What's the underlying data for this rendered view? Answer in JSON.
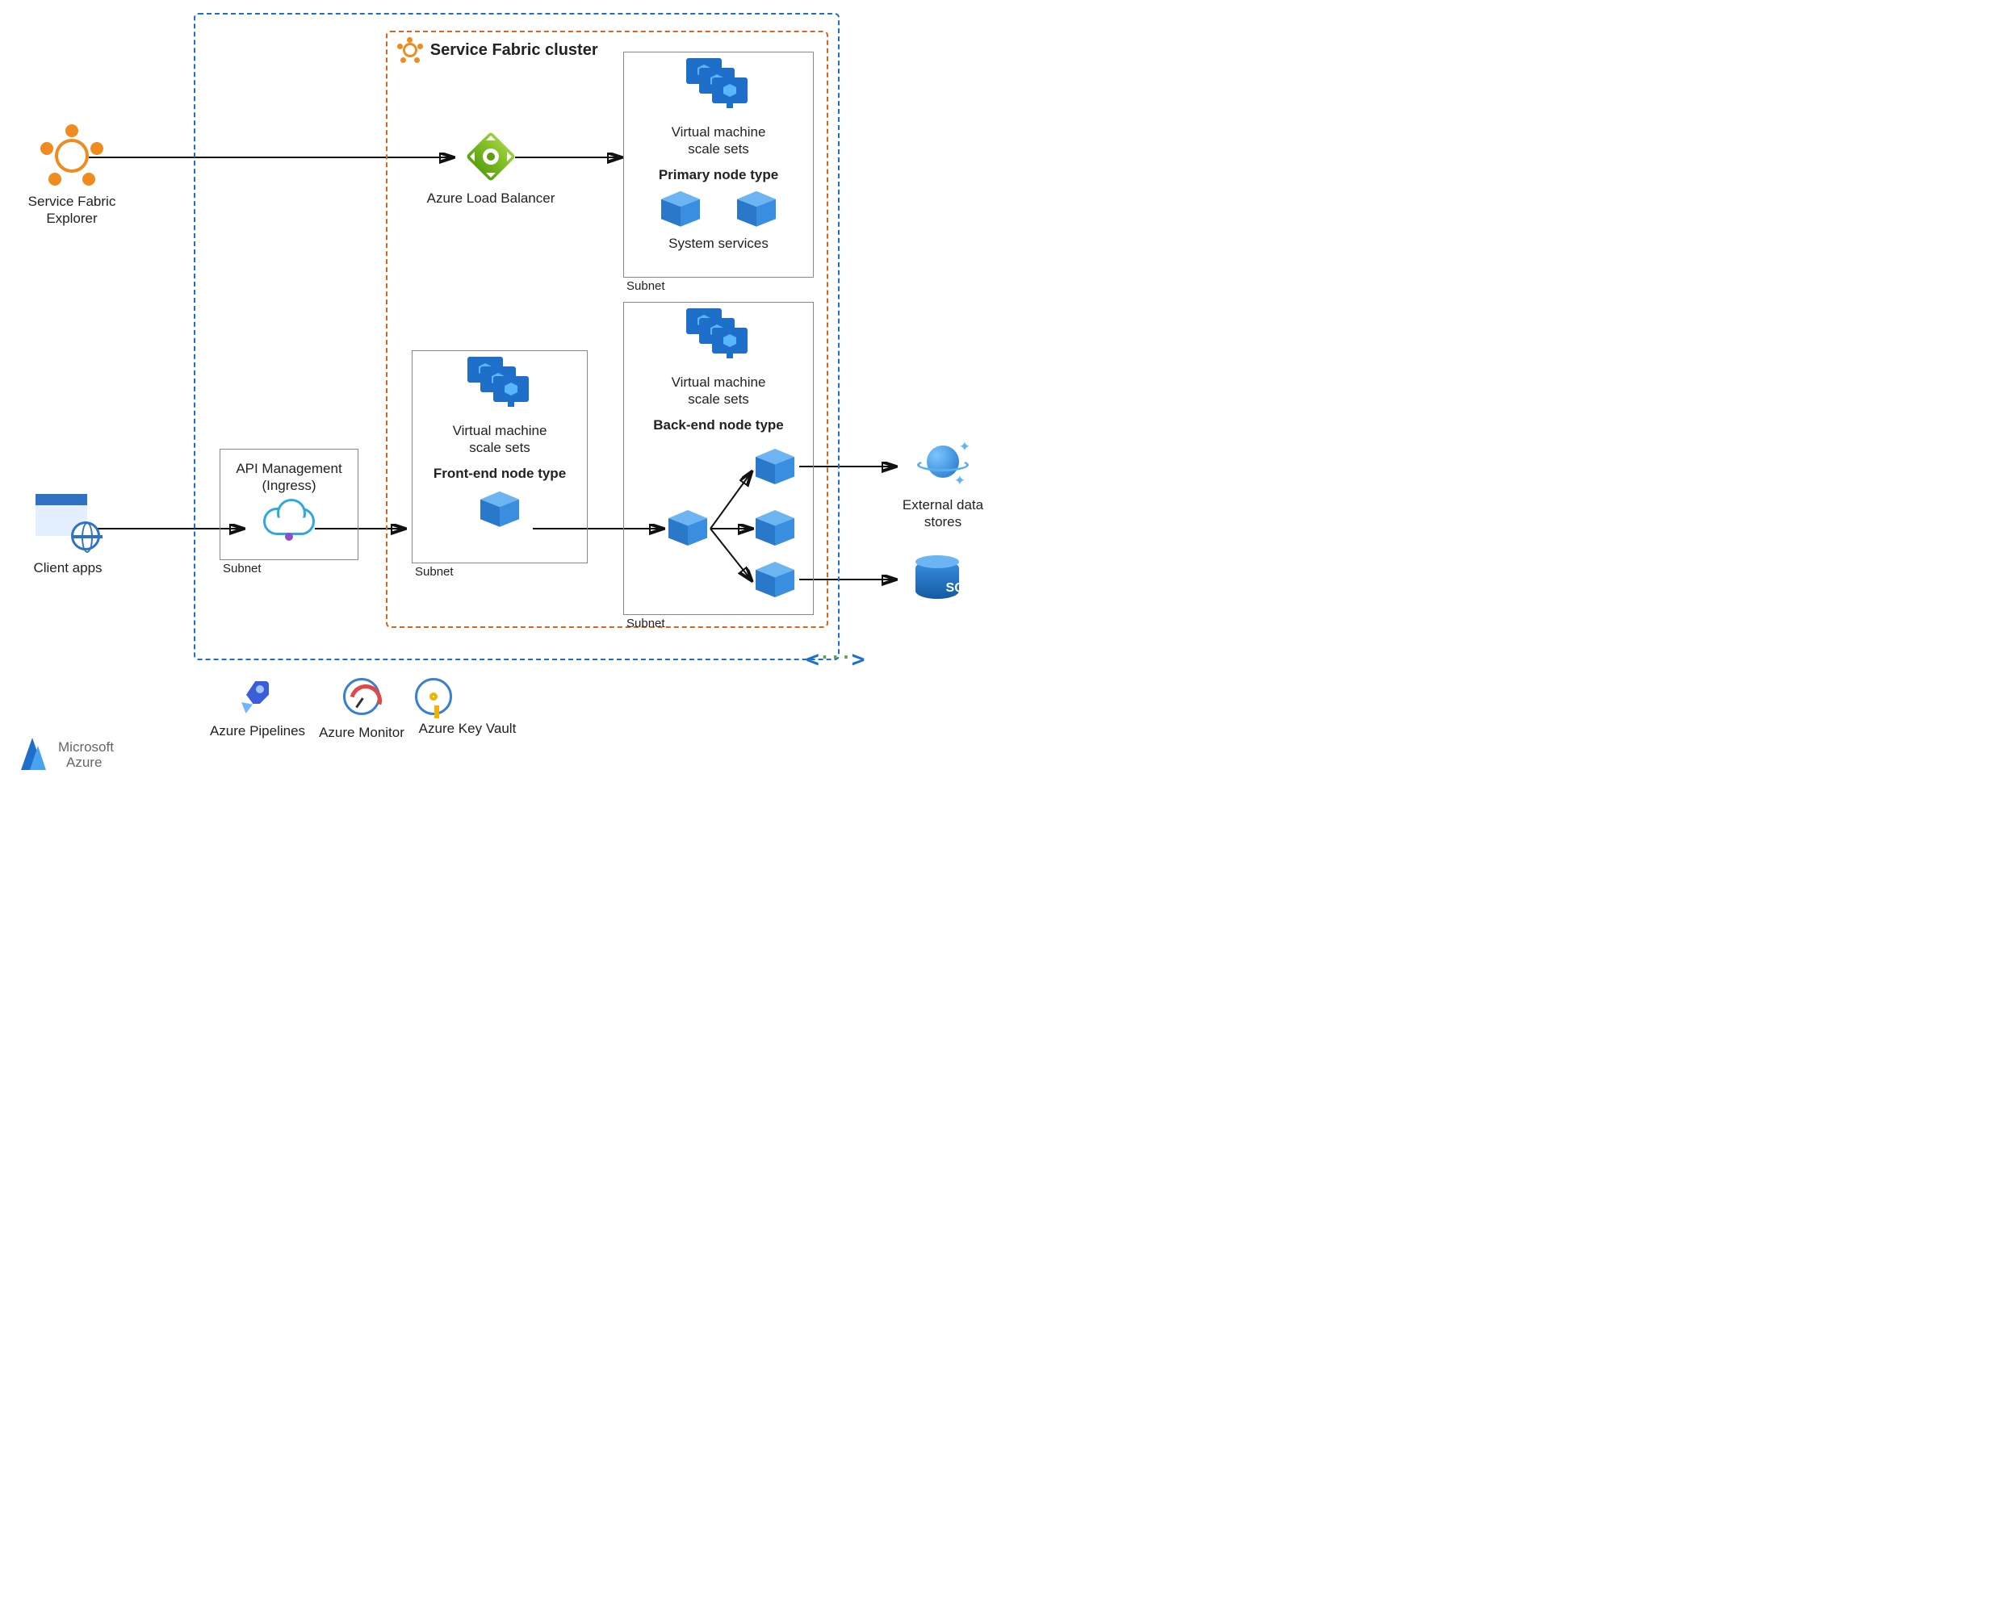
{
  "external": {
    "sf_explorer": "Service Fabric\nExplorer",
    "client_apps": "Client apps",
    "ext_stores": "External data\nstores",
    "sql": "SQL"
  },
  "vnet": {
    "apim_title": "API Management\n(Ingress)",
    "apim_subnet": "Subnet"
  },
  "cluster": {
    "title": "Service Fabric cluster",
    "alb": "Azure Load Balancer",
    "primary": {
      "vmss": "Virtual machine\nscale sets",
      "title": "Primary node type",
      "system": "System services",
      "subnet": "Subnet"
    },
    "frontend": {
      "vmss": "Virtual machine\nscale sets",
      "title": "Front-end node type",
      "subnet": "Subnet"
    },
    "backend": {
      "vmss": "Virtual machine\nscale sets",
      "title": "Back-end node type",
      "subnet": "Subnet"
    }
  },
  "footer": {
    "pipelines": "Azure Pipelines",
    "monitor": "Azure Monitor",
    "keyvault": "Azure Key Vault",
    "ms_azure_1": "Microsoft",
    "ms_azure_2": "Azure"
  }
}
